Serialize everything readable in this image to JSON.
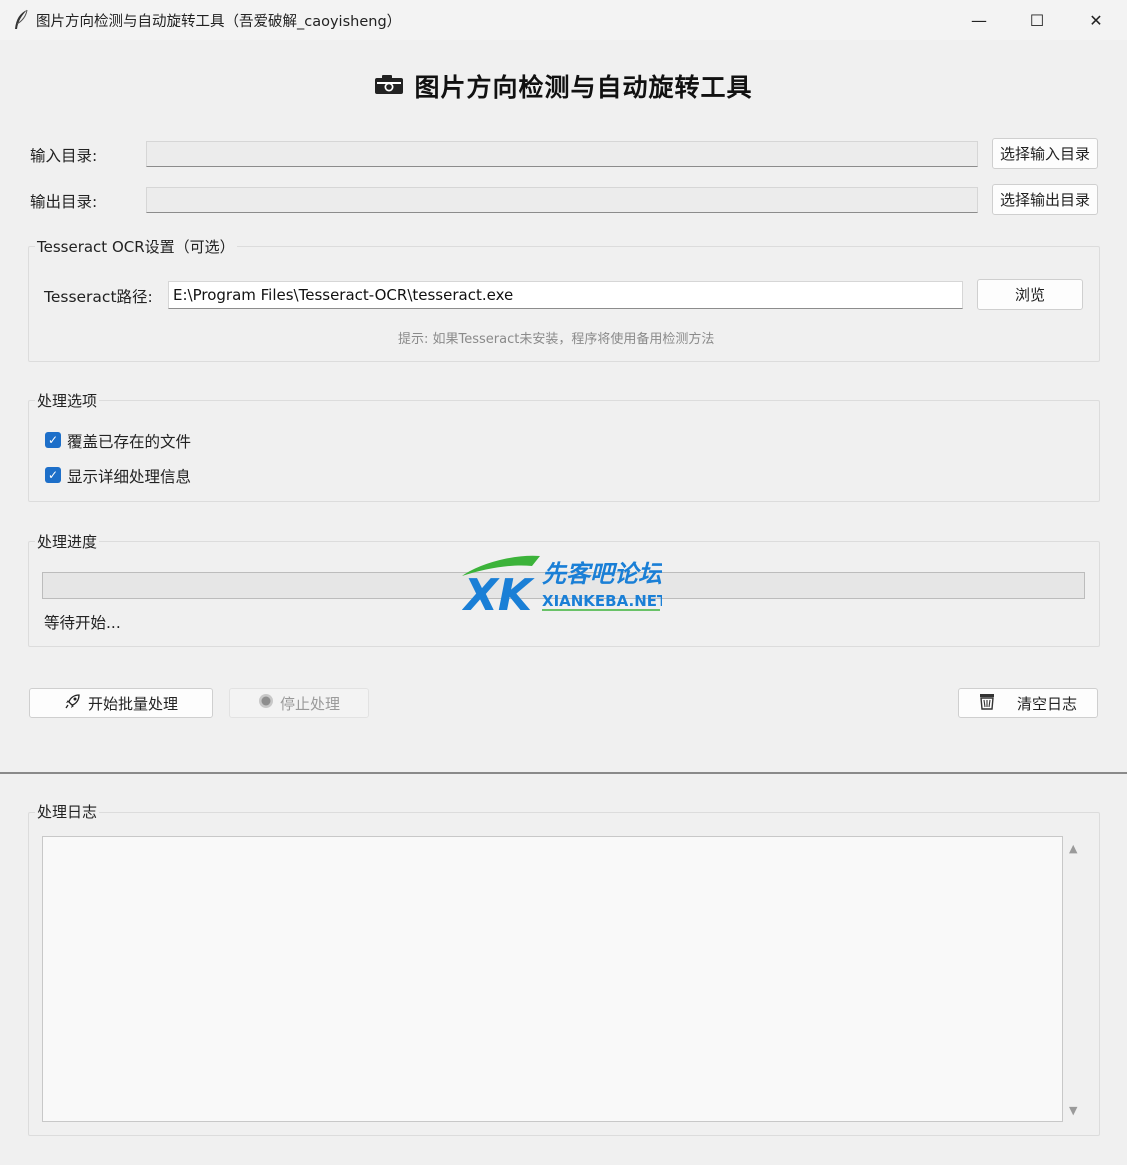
{
  "window": {
    "title": "图片方向检测与自动旋转工具（吾爱破解_caoyisheng）",
    "minimize_glyph": "—",
    "maximize_glyph": "☐",
    "close_glyph": "✕"
  },
  "header": {
    "icon": "camera-icon",
    "title": "图片方向检测与自动旋转工具"
  },
  "input_dir": {
    "label": "输入目录:",
    "value": "",
    "button_label": "选择输入目录"
  },
  "output_dir": {
    "label": "输出目录:",
    "value": "",
    "button_label": "选择输出目录"
  },
  "tesseract": {
    "group_title": "Tesseract OCR设置（可选）",
    "path_label": "Tesseract路径:",
    "path_value": "E:\\Program Files\\Tesseract-OCR\\tesseract.exe",
    "browse_label": "浏览",
    "hint": "提示: 如果Tesseract未安装，程序将使用备用检测方法"
  },
  "options": {
    "group_title": "处理选项",
    "overwrite_label": "覆盖已存在的文件",
    "overwrite_checked": true,
    "verbose_label": "显示详细处理信息",
    "verbose_checked": true,
    "check_glyph": "✓"
  },
  "progress": {
    "group_title": "处理进度",
    "value": 0,
    "status": "等待开始..."
  },
  "actions": {
    "start_label": "开始批量处理",
    "start_icon": "rocket-icon",
    "stop_label": "停止处理",
    "stop_icon": "stop-circle-icon",
    "stop_enabled": false,
    "clear_label": "清空日志",
    "clear_icon": "wastebasket-icon"
  },
  "log": {
    "group_title": "处理日志",
    "content": "",
    "scroll_up_glyph": "▲",
    "scroll_down_glyph": "▼"
  },
  "watermark": {
    "site_name": "先客吧论坛",
    "site_url": "XIANKEBA.NET",
    "logo_letters": "XK",
    "colors": {
      "green": "#3cb33a",
      "blue": "#1a7fd6"
    }
  },
  "colors": {
    "accent": "#1d6fc9",
    "background": "#f0f0f0"
  }
}
